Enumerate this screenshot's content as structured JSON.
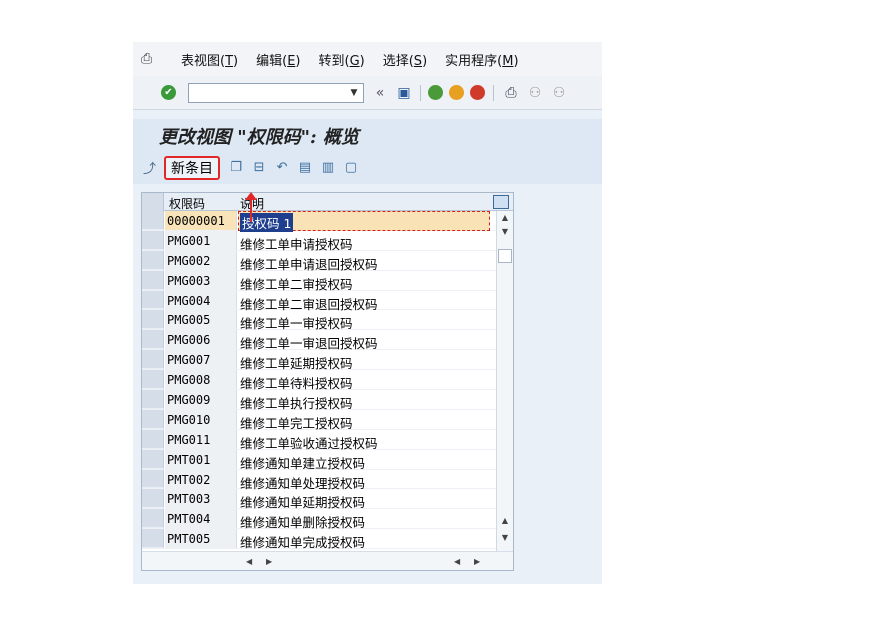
{
  "menubar": {
    "items": [
      {
        "label": "表视图(",
        "key": "T",
        "tail": ")"
      },
      {
        "label": "编辑(",
        "key": "E",
        "tail": ")"
      },
      {
        "label": "转到(",
        "key": "G",
        "tail": ")"
      },
      {
        "label": "选择(",
        "key": "S",
        "tail": ")"
      },
      {
        "label": "实用程序(",
        "key": "M",
        "tail": ")"
      }
    ]
  },
  "stdbar": {
    "command_value": "",
    "icons": [
      "ok-icon",
      "back-icon",
      "save-icon",
      "nav-back-icon",
      "exit-icon",
      "cancel-icon",
      "print-icon",
      "find-icon",
      "find-next-icon"
    ]
  },
  "title": "更改视图 \"权限码\": 概览",
  "appbar": {
    "new_entries_label": "新条目"
  },
  "table": {
    "headers": [
      "权限码",
      "说明"
    ],
    "rows": [
      {
        "code": "00000001",
        "desc": "授权码 1"
      },
      {
        "code": "PMG001",
        "desc": "维修工单申请授权码"
      },
      {
        "code": "PMG002",
        "desc": "维修工单申请退回授权码"
      },
      {
        "code": "PMG003",
        "desc": "维修工单二审授权码"
      },
      {
        "code": "PMG004",
        "desc": "维修工单二审退回授权码"
      },
      {
        "code": "PMG005",
        "desc": "维修工单一审授权码"
      },
      {
        "code": "PMG006",
        "desc": "维修工单一审退回授权码"
      },
      {
        "code": "PMG007",
        "desc": "维修工单延期授权码"
      },
      {
        "code": "PMG008",
        "desc": "维修工单待料授权码"
      },
      {
        "code": "PMG009",
        "desc": "维修工单执行授权码"
      },
      {
        "code": "PMG010",
        "desc": "维修工单完工授权码"
      },
      {
        "code": "PMG011",
        "desc": "维修工单验收通过授权码"
      },
      {
        "code": "PMT001",
        "desc": "维修通知单建立授权码"
      },
      {
        "code": "PMT002",
        "desc": "维修通知单处理授权码"
      },
      {
        "code": "PMT003",
        "desc": "维修通知单延期授权码"
      },
      {
        "code": "PMT004",
        "desc": "维修通知单删除授权码"
      },
      {
        "code": "PMT005",
        "desc": "维修通知单完成授权码"
      }
    ]
  },
  "colors": {
    "highlight_border": "#e02828",
    "selected_text_bg": "#1f3f8e"
  }
}
